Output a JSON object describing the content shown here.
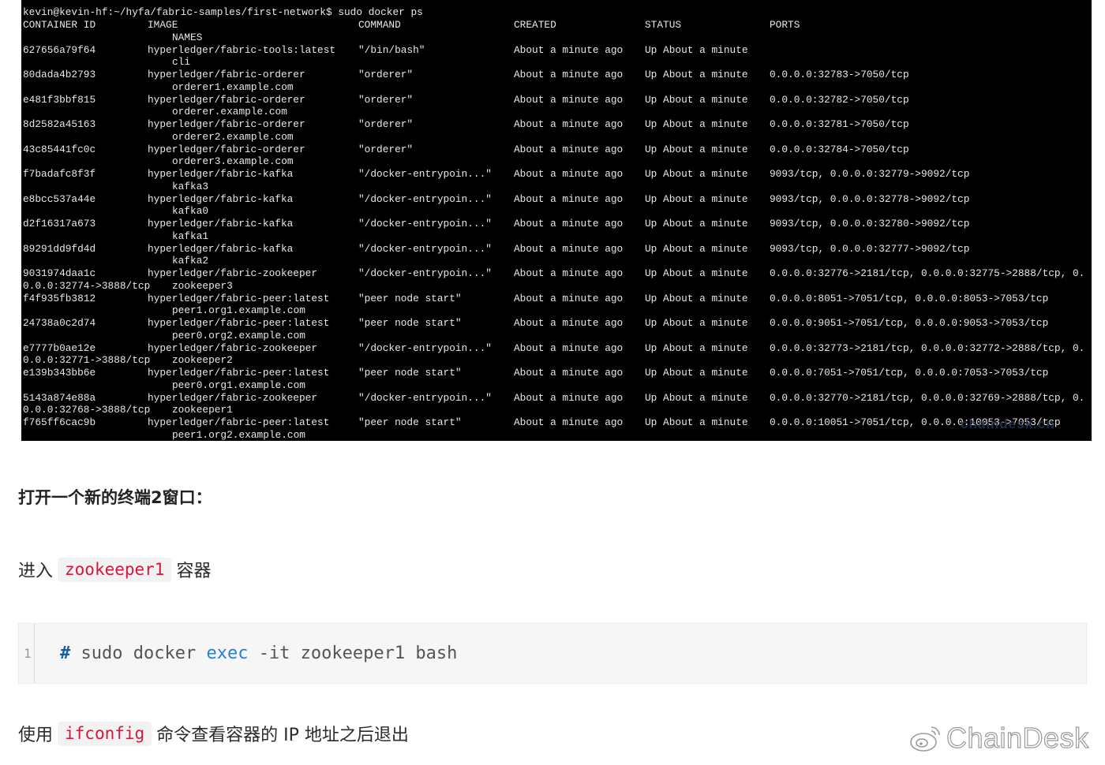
{
  "terminal": {
    "prompt": "kevin@kevin-hf:~/hyfa/fabric-samples/first-network$ sudo docker ps",
    "headers": {
      "container_id": "CONTAINER ID",
      "image": "IMAGE",
      "command": "COMMAND",
      "created": "CREATED",
      "status": "STATUS",
      "ports": "PORTS",
      "names": "NAMES"
    },
    "rows": [
      {
        "id": "627656a79f64",
        "image": "hyperledger/fabric-tools:latest",
        "command": "\"/bin/bash\"",
        "created": "About a minute ago",
        "status": "Up About a minute",
        "ports": "",
        "wrap_prefix": "",
        "name": "cli"
      },
      {
        "id": "80dada4b2793",
        "image": "hyperledger/fabric-orderer",
        "command": "\"orderer\"",
        "created": "About a minute ago",
        "status": "Up About a minute",
        "ports": "0.0.0.0:32783->7050/tcp",
        "wrap_prefix": "",
        "name": "orderer1.example.com"
      },
      {
        "id": "e481f3bbf815",
        "image": "hyperledger/fabric-orderer",
        "command": "\"orderer\"",
        "created": "About a minute ago",
        "status": "Up About a minute",
        "ports": "0.0.0.0:32782->7050/tcp",
        "wrap_prefix": "",
        "name": "orderer.example.com"
      },
      {
        "id": "8d2582a45163",
        "image": "hyperledger/fabric-orderer",
        "command": "\"orderer\"",
        "created": "About a minute ago",
        "status": "Up About a minute",
        "ports": "0.0.0.0:32781->7050/tcp",
        "wrap_prefix": "",
        "name": "orderer2.example.com"
      },
      {
        "id": "43c85441fc0c",
        "image": "hyperledger/fabric-orderer",
        "command": "\"orderer\"",
        "created": "About a minute ago",
        "status": "Up About a minute",
        "ports": "0.0.0.0:32784->7050/tcp",
        "wrap_prefix": "",
        "name": "orderer3.example.com"
      },
      {
        "id": "f7badafc8f3f",
        "image": "hyperledger/fabric-kafka",
        "command": "\"/docker-entrypoin...\"",
        "created": "About a minute ago",
        "status": "Up About a minute",
        "ports": "9093/tcp, 0.0.0.0:32779->9092/tcp",
        "wrap_prefix": "",
        "name": "kafka3"
      },
      {
        "id": "e8bcc537a44e",
        "image": "hyperledger/fabric-kafka",
        "command": "\"/docker-entrypoin...\"",
        "created": "About a minute ago",
        "status": "Up About a minute",
        "ports": "9093/tcp, 0.0.0.0:32778->9092/tcp",
        "wrap_prefix": "",
        "name": "kafka0"
      },
      {
        "id": "d2f16317a673",
        "image": "hyperledger/fabric-kafka",
        "command": "\"/docker-entrypoin...\"",
        "created": "About a minute ago",
        "status": "Up About a minute",
        "ports": "9093/tcp, 0.0.0.0:32780->9092/tcp",
        "wrap_prefix": "",
        "name": "kafka1"
      },
      {
        "id": "89291dd9fd4d",
        "image": "hyperledger/fabric-kafka",
        "command": "\"/docker-entrypoin...\"",
        "created": "About a minute ago",
        "status": "Up About a minute",
        "ports": "9093/tcp, 0.0.0.0:32777->9092/tcp",
        "wrap_prefix": "",
        "name": "kafka2"
      },
      {
        "id": "9031974daa1c",
        "image": "hyperledger/fabric-zookeeper",
        "command": "\"/docker-entrypoin...\"",
        "created": "About a minute ago",
        "status": "Up About a minute",
        "ports": "0.0.0.0:32776->2181/tcp, 0.0.0.0:32775->2888/tcp, 0.",
        "wrap_prefix": "0.0.0:32774->3888/tcp",
        "name": "zookeeper3"
      },
      {
        "id": "f4f935fb3812",
        "image": "hyperledger/fabric-peer:latest",
        "command": "\"peer node start\"",
        "created": "About a minute ago",
        "status": "Up About a minute",
        "ports": "0.0.0.0:8051->7051/tcp, 0.0.0.0:8053->7053/tcp",
        "wrap_prefix": "",
        "name": "peer1.org1.example.com"
      },
      {
        "id": "24738a0c2d74",
        "image": "hyperledger/fabric-peer:latest",
        "command": "\"peer node start\"",
        "created": "About a minute ago",
        "status": "Up About a minute",
        "ports": "0.0.0.0:9051->7051/tcp, 0.0.0.0:9053->7053/tcp",
        "wrap_prefix": "",
        "name": "peer0.org2.example.com"
      },
      {
        "id": "e7777b0ae12e",
        "image": "hyperledger/fabric-zookeeper",
        "command": "\"/docker-entrypoin...\"",
        "created": "About a minute ago",
        "status": "Up About a minute",
        "ports": "0.0.0.0:32773->2181/tcp, 0.0.0.0:32772->2888/tcp, 0.",
        "wrap_prefix": "0.0.0:32771->3888/tcp",
        "name": "zookeeper2"
      },
      {
        "id": "e139b343bb6e",
        "image": "hyperledger/fabric-peer:latest",
        "command": "\"peer node start\"",
        "created": "About a minute ago",
        "status": "Up About a minute",
        "ports": "0.0.0.0:7051->7051/tcp, 0.0.0.0:7053->7053/tcp",
        "wrap_prefix": "",
        "name": "peer0.org1.example.com"
      },
      {
        "id": "5143a874e88a",
        "image": "hyperledger/fabric-zookeeper",
        "command": "\"/docker-entrypoin...\"",
        "created": "About a minute ago",
        "status": "Up About a minute",
        "ports": "0.0.0.0:32770->2181/tcp, 0.0.0.0:32769->2888/tcp, 0.",
        "wrap_prefix": "0.0.0:32768->3888/tcp",
        "name": "zookeeper1"
      },
      {
        "id": "f765ff6cac9b",
        "image": "hyperledger/fabric-peer:latest",
        "command": "\"peer node start\"",
        "created": "About a minute ago",
        "status": "Up About a minute",
        "ports": "0.0.0.0:10051->7051/tcp, 0.0.0.0:10053->7053/tcp",
        "wrap_prefix": "",
        "name": "peer1.org2.example.com"
      }
    ]
  },
  "article": {
    "heading": "打开一个新的终端2窗口：",
    "p1_before": "进入",
    "p1_code": "zookeeper1",
    "p1_after": "容器",
    "code_line_number": "1",
    "code_hash": "#",
    "code_pre": "sudo docker",
    "code_kw": "exec",
    "code_post": "-it zookeeper1 bash",
    "p2_before": "使用",
    "p2_code": "ifconfig",
    "p2_after": "命令查看容器的 IP 地址之后退出"
  },
  "watermark": {
    "brand": "ChainDesk",
    "icon": "weibo-icon"
  }
}
